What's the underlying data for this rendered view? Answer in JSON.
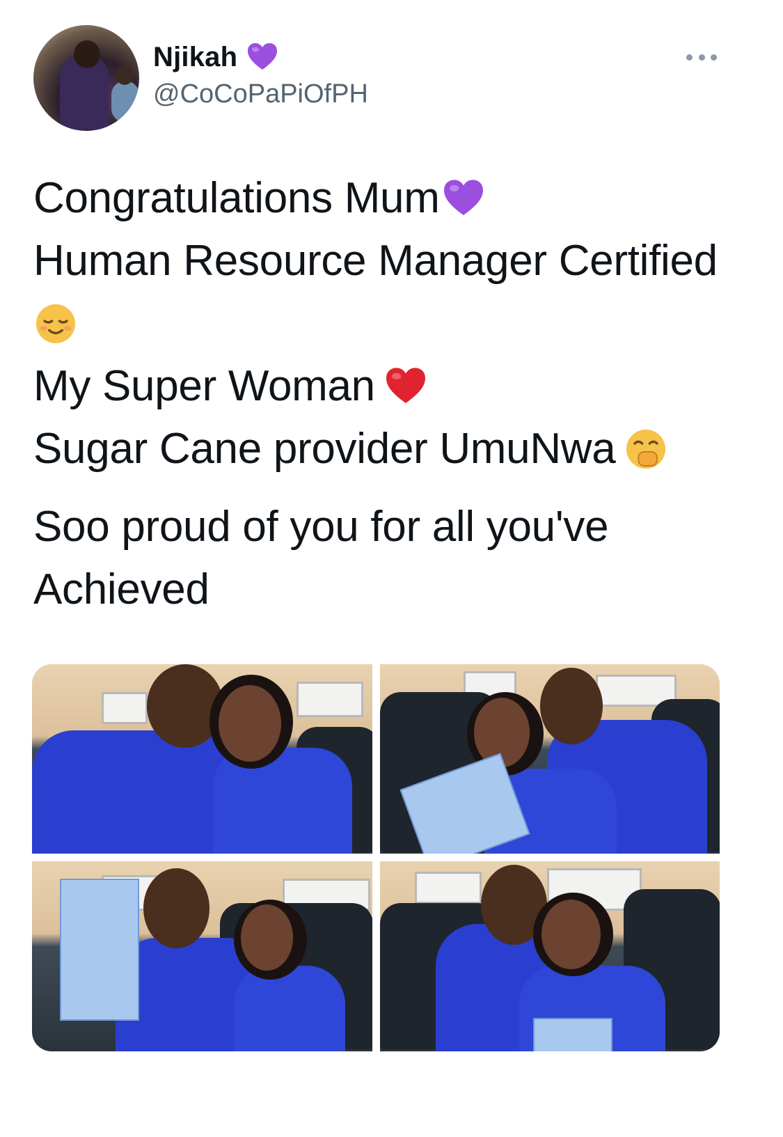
{
  "tweet": {
    "author_name": "Njikah",
    "author_badge_icon": "purple-heart-emoji",
    "handle": "@CoCoPaPiOfPH",
    "more_icon": "more-dots-icon",
    "lines": [
      {
        "text": "Congratulations Mum",
        "emoji": "purple-heart"
      },
      {
        "text": "Human Resource Manager Certified",
        "emoji": ""
      },
      {
        "text": "",
        "emoji": "relieved-face"
      },
      {
        "text": "My Super Woman ",
        "emoji": "red-heart"
      },
      {
        "text": "Sugar Cane provider UmuNwa ",
        "emoji": "hand-over-mouth"
      },
      {
        "text": "Soo proud of you for all you've",
        "emoji": ""
      },
      {
        "text": "Achieved",
        "emoji": ""
      }
    ],
    "photos": [
      {
        "alt": "photo-1"
      },
      {
        "alt": "photo-2"
      },
      {
        "alt": "photo-3"
      },
      {
        "alt": "photo-4"
      }
    ]
  },
  "colors": {
    "text": "#0f1419",
    "secondary": "#536471",
    "purple_heart": "#9b4ee0",
    "red_heart": "#e0242f",
    "emoji_yellow": "#f6c24a",
    "outfit_blue": "#2a3fd0"
  }
}
